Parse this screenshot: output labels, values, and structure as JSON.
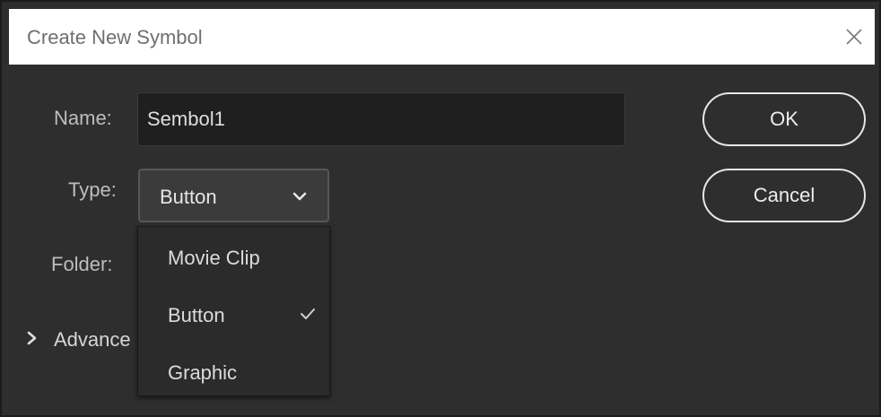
{
  "dialog": {
    "title": "Create New Symbol",
    "close_icon": "close-icon"
  },
  "form": {
    "name_label": "Name:",
    "name_value": "Sembol1",
    "type_label": "Type:",
    "type_selected": "Button",
    "folder_label": "Folder:",
    "advanced_label": "Advance"
  },
  "dropdown": {
    "items": [
      {
        "label": "Movie Clip",
        "checked": false
      },
      {
        "label": "Button",
        "checked": true
      },
      {
        "label": "Graphic",
        "checked": false
      }
    ]
  },
  "buttons": {
    "ok_label": "OK",
    "cancel_label": "Cancel"
  },
  "colors": {
    "background": "#2e2e2e",
    "titlebar": "#ffffff",
    "input_bg": "#1f1f1f"
  }
}
